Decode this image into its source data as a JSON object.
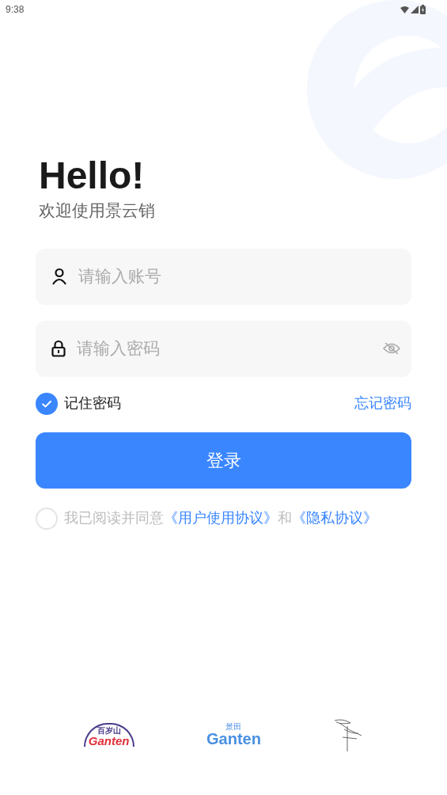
{
  "status_bar": {
    "time": "9:38"
  },
  "title": "Hello!",
  "subtitle": "欢迎使用景云销",
  "fields": [
    {
      "kind": "account",
      "placeholder": "请输入账号"
    },
    {
      "kind": "password",
      "placeholder": "请输入密码"
    }
  ],
  "remember": {
    "label": "记住密码",
    "checked": true
  },
  "forgot": "忘记密码",
  "login_button": "登录",
  "agreement": {
    "checked": false,
    "parts": [
      {
        "kind": "plain",
        "text": "我已阅读并同意"
      },
      {
        "kind": "link",
        "text": "《用户使用协议》"
      },
      {
        "kind": "plain",
        "text": "和"
      },
      {
        "kind": "link",
        "text": "《隐私协议》"
      }
    ]
  },
  "partner_logos": [
    {
      "kind": "badge",
      "lines": [
        "百岁山",
        "Ganten"
      ]
    },
    {
      "kind": "wordmark",
      "lines": [
        "景田",
        "Ganten"
      ]
    },
    {
      "kind": "signature"
    }
  ]
}
